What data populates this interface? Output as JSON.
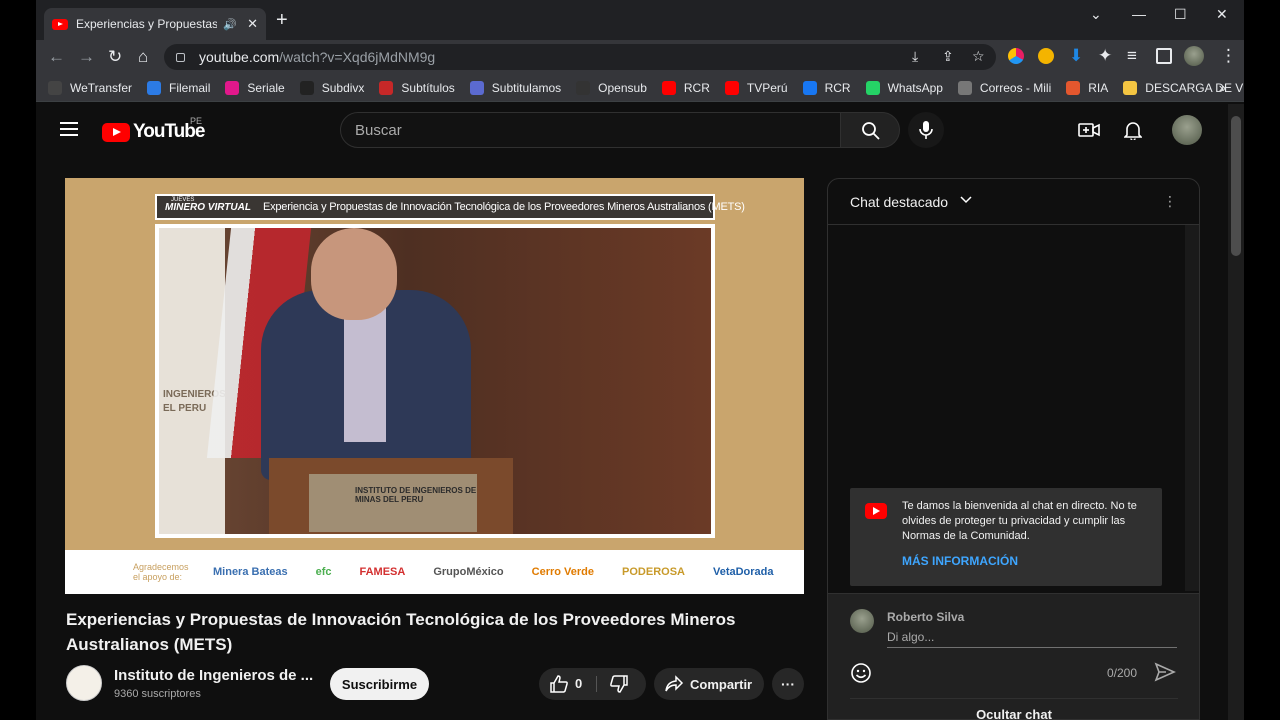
{
  "browser": {
    "tab_title": "Experiencias y Propuestas de",
    "url_host": "youtube.com",
    "url_path": "/watch?v=Xqd6jMdNM9g"
  },
  "bookmarks": [
    {
      "label": "WeTransfer",
      "color": "#444444"
    },
    {
      "label": "Filemail",
      "color": "#2c7be5"
    },
    {
      "label": "Seriale",
      "color": "#e2188b"
    },
    {
      "label": "Subdivx",
      "color": "#222222"
    },
    {
      "label": "Subtítulos",
      "color": "#c62828"
    },
    {
      "label": "Subtitulamos",
      "color": "#5b6ad0"
    },
    {
      "label": "Opensub",
      "color": "#333333"
    },
    {
      "label": "RCR",
      "color": "#ff0000"
    },
    {
      "label": "TVPerú",
      "color": "#ff0000"
    },
    {
      "label": "RCR",
      "color": "#1877f2"
    },
    {
      "label": "WhatsApp",
      "color": "#25d366"
    },
    {
      "label": "Correos - Mili",
      "color": "#777777"
    },
    {
      "label": "RIA",
      "color": "#e4572e"
    },
    {
      "label": "DESCARGA DE VÍDE...",
      "color": "#f4c542"
    }
  ],
  "youtube": {
    "region": "PE",
    "logo_text": "YouTube",
    "search_placeholder": "Buscar"
  },
  "video": {
    "banner_brand": "MINERO VIRTUAL",
    "banner_tag": "JUEVES",
    "banner_title": "Experiencia y Propuestas de Innovación Tecnológica de los Proveedores Mineros Australianos (METS)",
    "lectern_text": "INSTITUTO DE INGENIEROS DE MINAS DEL PERU",
    "seal_text": "INGENIEROS EL PERU",
    "sponsors": [
      {
        "label": "Agradecemos el apoyo de:",
        "color": "#c8a060"
      },
      {
        "label": "Minera Bateas",
        "color": "#3a6fb0"
      },
      {
        "label": "efc",
        "color": "#4caf50"
      },
      {
        "label": "FAMESA",
        "color": "#d32f2f"
      },
      {
        "label": "GrupoMéxico",
        "color": "#555555"
      },
      {
        "label": "Cerro Verde",
        "color": "#e07b00"
      },
      {
        "label": "PODEROSA",
        "color": "#c89a2a"
      },
      {
        "label": "VetaDorada",
        "color": "#1f5fa8"
      }
    ],
    "title": "Experiencias y Propuestas de Innovación Tecnológica de los Proveedores Mineros Australianos (METS)",
    "channel_name": "Instituto de Ingenieros de ...",
    "channel_subs": "9360 suscriptores",
    "subscribe_label": "Suscribirme",
    "like_count": "0",
    "share_label": "Compartir"
  },
  "chat": {
    "title": "Chat destacado",
    "welcome_text": "Te damos la bienvenida al chat en directo. No te olvides de proteger tu privacidad y cumplir las Normas de la Comunidad.",
    "welcome_link": "MÁS INFORMACIÓN",
    "user_name": "Roberto Silva",
    "input_placeholder": "Di algo...",
    "char_count": "0/200",
    "hide_label": "Ocultar chat"
  }
}
